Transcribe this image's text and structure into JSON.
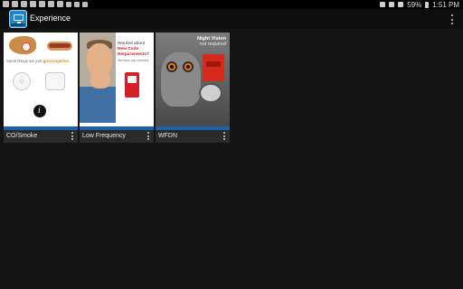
{
  "status_bar": {
    "battery": "59%",
    "time": "1:51 PM"
  },
  "app_bar": {
    "title": "Experience",
    "icon": "display-monitor-icon",
    "overflow_icon": "more-vert-icon"
  },
  "cards": [
    {
      "label": "CO/Smoke",
      "thumbnail_text": {
        "tagline_prefix": "Some things are just ",
        "tagline_highlight": "great together",
        "tagline_suffix": ".",
        "logo_letter": "i"
      }
    },
    {
      "label": "Low Frequency",
      "thumbnail_text": {
        "line1": "Worried about",
        "line2": "New Code",
        "line3": "Requirements?",
        "line4": "We have you covered."
      }
    },
    {
      "label": "WFDN",
      "thumbnail_text": {
        "title": "Night Vision",
        "subtitle": "not required"
      }
    }
  ],
  "colors": {
    "background": "#141414",
    "accent_blue": "#1d5fa8",
    "highlight_orange": "#e08a1a",
    "highlight_red": "#d2232a"
  }
}
